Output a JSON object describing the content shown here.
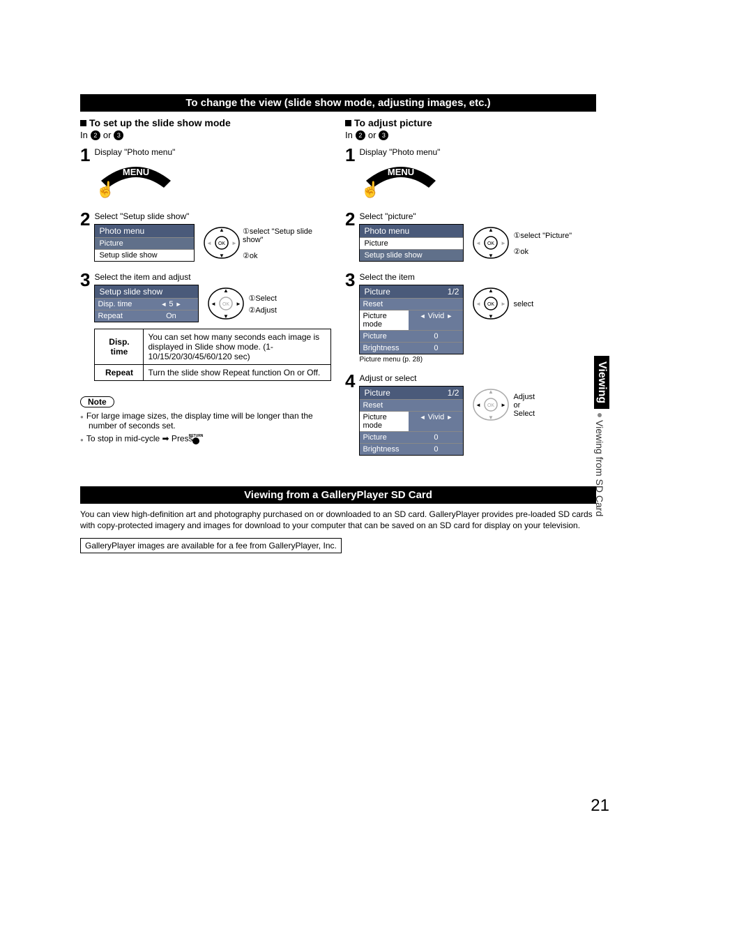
{
  "header1": "To change the view (slide show mode, adjusting images, etc.)",
  "left": {
    "title": "To set up the slide show mode",
    "in_prefix": "In",
    "in_or": "or",
    "steps": {
      "s1": {
        "t": "Display \"Photo menu\"",
        "menu": "MENU"
      },
      "s2": {
        "t": "Select \"Setup slide show\"",
        "pm_title": "Photo menu",
        "pm_items": [
          "Picture",
          "Setup slide show"
        ],
        "lab1": "select \"Setup slide show\"",
        "lab2": "ok",
        "c1": "①",
        "c2": "②"
      },
      "s3": {
        "t": "Select the item and adjust",
        "sm_title": "Setup slide show",
        "rows": [
          {
            "lab": "Disp. time",
            "val": "5",
            "arrows": true
          },
          {
            "lab": "Repeat",
            "val": "On"
          }
        ],
        "lab1": "Select",
        "lab2": "Adjust",
        "c1": "①",
        "c2": "②"
      }
    },
    "def": [
      {
        "k": "Disp. time",
        "v": "You can set how many seconds each image is displayed in Slide show mode. (1-10/15/20/30/45/60/120 sec)"
      },
      {
        "k": "Repeat",
        "v": "Turn the slide show Repeat function On or Off."
      }
    ],
    "note_label": "Note",
    "notes": [
      "For large image sizes, the display time will be longer than the number of seconds set.",
      "To stop in mid-cycle ➡ Press"
    ],
    "return_label": "RETURN"
  },
  "right": {
    "title": "To adjust picture",
    "in_prefix": "In",
    "in_or": "or",
    "steps": {
      "s1": {
        "t": "Display \"Photo menu\"",
        "menu": "MENU"
      },
      "s2": {
        "t": "Select \"picture\"",
        "pm_title": "Photo menu",
        "pm_items": [
          "Picture",
          "Setup slide show"
        ],
        "lab1": "select \"Picture\"",
        "lab2": "ok",
        "c1": "①",
        "c2": "②"
      },
      "s3": {
        "t": "Select the item",
        "sm_title": "Picture",
        "page": "1/2",
        "rows": [
          {
            "lab": "Reset",
            "val": ""
          },
          {
            "lab": "Picture mode",
            "val": "Vivid",
            "arrows": true
          },
          {
            "lab": "Picture",
            "val": "0"
          },
          {
            "lab": "Brightness",
            "val": "0"
          }
        ],
        "lab1": "select",
        "note_below": "Picture menu (p. 28)"
      },
      "s4": {
        "t": "Adjust or select",
        "sm_title": "Picture",
        "page": "1/2",
        "rows": [
          {
            "lab": "Reset",
            "val": ""
          },
          {
            "lab": "Picture mode",
            "val": "Vivid",
            "arrows": true
          },
          {
            "lab": "Picture",
            "val": "0"
          },
          {
            "lab": "Brightness",
            "val": "0"
          }
        ],
        "lab1": "Adjust",
        "lab2": "or",
        "lab3": "Select"
      }
    }
  },
  "header2": "Viewing from a GalleryPlayer SD Card",
  "gp_para": "You can view high-definition art and photography purchased on or downloaded to an SD card. GalleryPlayer provides pre-loaded SD cards with copy-protected imagery and images for download to your computer that can be saved on an SD card for display on your television.",
  "gp_box": "GalleryPlayer images are available for a fee from GalleryPlayer, Inc.",
  "side": {
    "main": "Viewing",
    "sub": "Viewing from SD Card"
  },
  "page_num": "21",
  "circles": {
    "two": "2",
    "three": "3"
  }
}
